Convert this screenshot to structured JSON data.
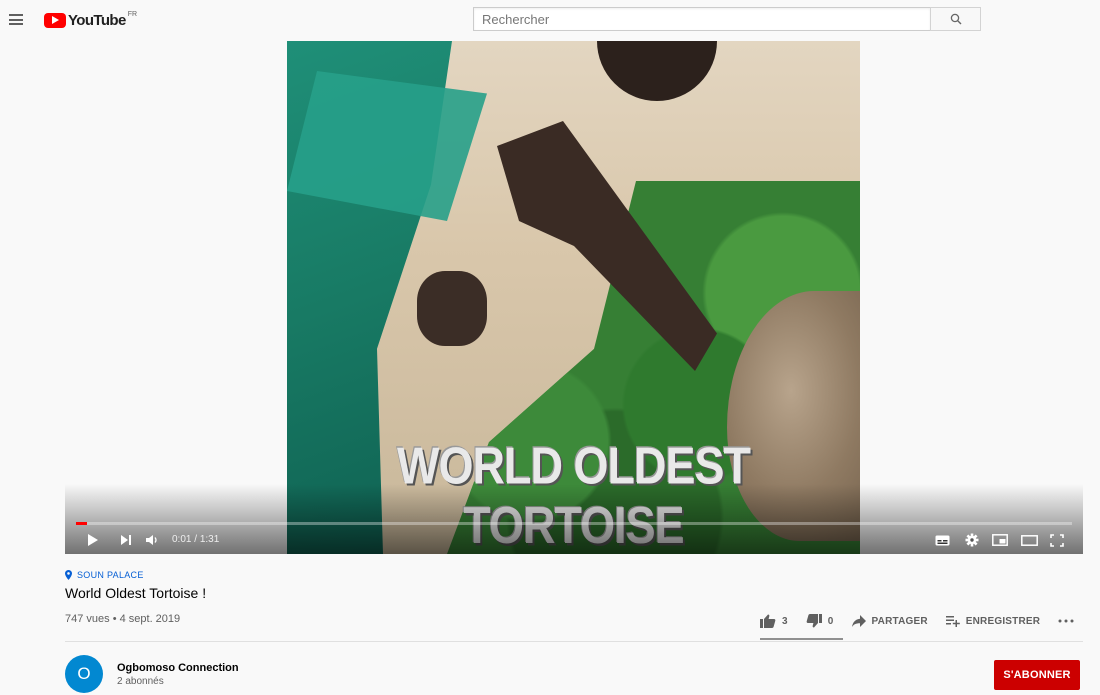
{
  "masthead": {
    "logo_text": "YouTube",
    "region": "FR",
    "search_placeholder": "Rechercher"
  },
  "player": {
    "overlay_text": "WORLD OLDEST TORTOISE",
    "current_time": "0:01",
    "duration": "1:31",
    "time_separator": " / ",
    "progress_fraction": 0.011
  },
  "video": {
    "location": "SOUN PALACE",
    "title": "World Oldest Tortoise !",
    "stats": "747 vues • 4 sept. 2019",
    "likes": "3",
    "dislikes": "0",
    "share_label": "PARTAGER",
    "save_label": "ENREGISTRER"
  },
  "channel": {
    "avatar_letter": "O",
    "name": "Ogbomoso Connection",
    "subscribers": "2 abonnés",
    "subscribe_label": "S'ABONNER"
  },
  "colors": {
    "brand_red": "#ff0000",
    "subscribe_red": "#cc0000",
    "link_blue": "#065fd4",
    "avatar_blue": "#0288d1"
  }
}
